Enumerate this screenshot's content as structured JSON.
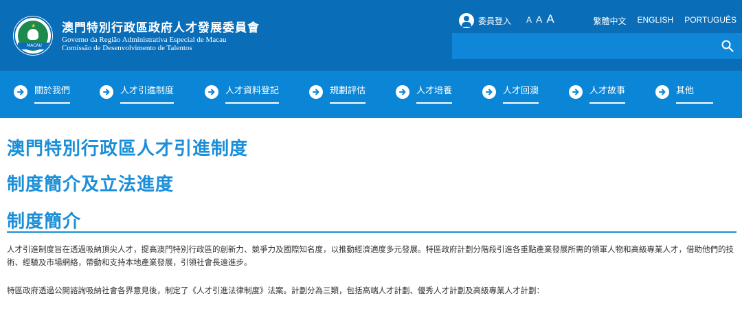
{
  "header": {
    "org_title_zh": "澳門特別行政區政府人才發展委員會",
    "org_title_pt1": "Governo da Região Administrativa Especial de Macau",
    "org_title_pt2": "Comissão de Desenvolvimento de Talentos",
    "emblem_text": "MACAU",
    "login_label": "委員登入",
    "font_sizes": [
      "A",
      "A",
      "A"
    ],
    "languages": [
      "繁體中文",
      "ENGLISH",
      "PORTUGUÊS"
    ]
  },
  "nav": {
    "items": [
      {
        "label": "關於我們"
      },
      {
        "label": "人才引進制度"
      },
      {
        "label": "人才資料登記"
      },
      {
        "label": "規劃評估"
      },
      {
        "label": "人才培養"
      },
      {
        "label": "人才回澳"
      },
      {
        "label": "人才故事"
      },
      {
        "label": "其他"
      }
    ]
  },
  "content": {
    "title": "澳門特別行政區人才引進制度",
    "subtitle": "制度簡介及立法進度",
    "section_title": "制度簡介",
    "paragraph1": "人才引進制度旨在透過吸納頂尖人才，提高澳門特別行政區的創新力、競爭力及國際知名度，以推動經濟適度多元發展。特區政府計劃分階段引進各重點產業發展所需的領軍人物和高級專業人才，借助他們的技術、經驗及市場網絡，帶動和支持本地產業發展，引領社會長遠進步。",
    "paragraph2": "特區政府透過公開諮詢吸納社會各界意見後，制定了《人才引進法律制度》法案。計劃分為三類，包括高端人才計劃、優秀人才計劃及高級專業人才計劃："
  },
  "colors": {
    "header_bg": "#0a6db8",
    "nav_bg": "#0b86d6",
    "accent": "#1a8ed8"
  }
}
